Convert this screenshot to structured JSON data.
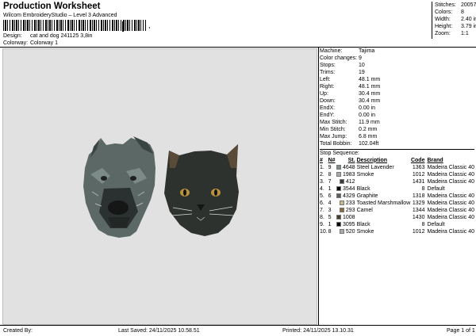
{
  "header": {
    "title": "Production Worksheet",
    "subtitle": "Wilcom EmbroideryStudio – Level 3 Advanced",
    "barcode_tail": ",",
    "design_label": "Design:",
    "design_value": "cat and dog 241125 3,8in",
    "colorway_label": "Colorway:",
    "colorway_value": "Colorway 1"
  },
  "stats": [
    {
      "k": "Stitches:",
      "v": "20057"
    },
    {
      "k": "Colors:",
      "v": "8"
    },
    {
      "k": "Width:",
      "v": "2.40 in"
    },
    {
      "k": "Height:",
      "v": "3.79 in"
    },
    {
      "k": "Zoom:",
      "v": "1:1"
    }
  ],
  "machine": [
    {
      "k": "Machine:",
      "v": "Tajima"
    },
    {
      "k": "Color changes:",
      "v": "9"
    },
    {
      "k": "Stops:",
      "v": "10"
    },
    {
      "k": "Trims:",
      "v": "19"
    },
    {
      "k": "Left:",
      "v": "48.1 mm"
    },
    {
      "k": "Right:",
      "v": "48.1 mm"
    },
    {
      "k": "Up:",
      "v": "30.4 mm"
    },
    {
      "k": "Down:",
      "v": "30.4 mm"
    },
    {
      "k": "EndX:",
      "v": "0.00 in"
    },
    {
      "k": "EndY:",
      "v": "0.00 in"
    },
    {
      "k": "Max Stitch:",
      "v": "11.9 mm"
    },
    {
      "k": "Min Stitch:",
      "v": "0.2 mm"
    },
    {
      "k": "Max Jump:",
      "v": "6.8 mm"
    },
    {
      "k": "Total Bobbin:",
      "v": "102.04ft"
    }
  ],
  "sequence": {
    "title": "Stop Sequence:",
    "headers": [
      "#",
      "N#",
      "St.",
      "Description",
      "Code",
      "Brand"
    ],
    "rows": [
      {
        "n": "1.",
        "nn": "9",
        "color": "#7f8b8d",
        "st": "4648",
        "desc": "Steel Lavender",
        "code": "1363",
        "brand": "Madeira Classic 40"
      },
      {
        "n": "2.",
        "nn": "8",
        "color": "#a9aaa6",
        "st": "1983",
        "desc": "Smoke",
        "code": "1012",
        "brand": "Madeira Classic 40"
      },
      {
        "n": "3.",
        "nn": "7",
        "color": "#3a3a3a",
        "st": "412",
        "desc": "",
        "code": "1431",
        "brand": "Madeira Classic 40"
      },
      {
        "n": "4.",
        "nn": "1",
        "color": "#000000",
        "st": "3544",
        "desc": "Black",
        "code": "8",
        "brand": "Default"
      },
      {
        "n": "5.",
        "nn": "6",
        "color": "#5b5d5c",
        "st": "4329",
        "desc": "Graphite",
        "code": "1318",
        "brand": "Madeira Classic 40"
      },
      {
        "n": "6.",
        "nn": "4",
        "color": "#c9b68a",
        "st": "233",
        "desc": "Toasted Marshmallow",
        "code": "1329",
        "brand": "Madeira Classic 40"
      },
      {
        "n": "7.",
        "nn": "3",
        "color": "#8a6a3c",
        "st": "293",
        "desc": "Camel",
        "code": "1344",
        "brand": "Madeira Classic 40"
      },
      {
        "n": "8.",
        "nn": "5",
        "color": "#4a3a2a",
        "st": "1008",
        "desc": "",
        "code": "1430",
        "brand": "Madeira Classic 40"
      },
      {
        "n": "9.",
        "nn": "1",
        "color": "#000000",
        "st": "3095",
        "desc": "Black",
        "code": "8",
        "brand": "Default"
      },
      {
        "n": "10.",
        "nn": "8",
        "color": "#a9aaa6",
        "st": "520",
        "desc": "Smoke",
        "code": "1012",
        "brand": "Madeira Classic 40"
      }
    ]
  },
  "footer": {
    "created_by": "Created By:",
    "last_saved": "Last Saved: 24/11/2025 10.58.51",
    "printed": "Printed: 24/11/2025 13.10.31",
    "page": "Page 1 of 1"
  }
}
